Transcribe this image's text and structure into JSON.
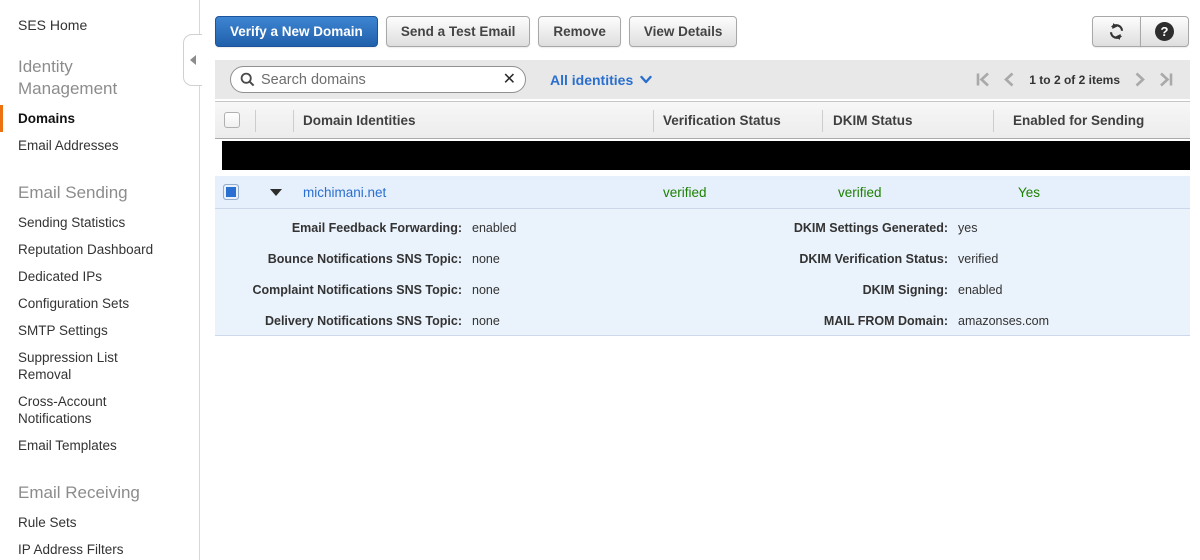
{
  "sidebar": {
    "home": "SES Home",
    "sections": [
      {
        "header": "Identity Management",
        "items": [
          "Domains",
          "Email Addresses"
        ]
      },
      {
        "header": "Email Sending",
        "items": [
          "Sending Statistics",
          "Reputation Dashboard",
          "Dedicated IPs",
          "Configuration Sets",
          "SMTP Settings",
          "Suppression List Removal",
          "Cross-Account Notifications",
          "Email Templates"
        ]
      },
      {
        "header": "Email Receiving",
        "items": [
          "Rule Sets",
          "IP Address Filters"
        ]
      }
    ],
    "active_item": "Domains"
  },
  "toolbar": {
    "verify_button": "Verify a New Domain",
    "test_email_button": "Send a Test Email",
    "remove_button": "Remove",
    "view_details_button": "View Details",
    "icons": {
      "refresh": "circular-refresh-arrows",
      "help": "?"
    }
  },
  "filter_bar": {
    "search_placeholder": "Search domains",
    "clear_glyph": "✕",
    "identity_filter_label": "All identities",
    "pagination_text": "1 to 2 of 2 items"
  },
  "table": {
    "headers": {
      "domain": "Domain Identities",
      "verification": "Verification Status",
      "dkim": "DKIM Status",
      "enabled": "Enabled for Sending"
    },
    "redacted_row": {
      "redacted": true
    },
    "domain_row": {
      "selected": true,
      "expanded": true,
      "domain": "michimani.net",
      "verification_status": "verified",
      "dkim_status": "verified",
      "enabled_for_sending": "Yes",
      "details": {
        "left": [
          {
            "label": "Email Feedback Forwarding:",
            "value": "enabled"
          },
          {
            "label": "Bounce Notifications SNS Topic:",
            "value": "none"
          },
          {
            "label": "Complaint Notifications SNS Topic:",
            "value": "none"
          },
          {
            "label": "Delivery Notifications SNS Topic:",
            "value": "none"
          }
        ],
        "right": [
          {
            "label": "DKIM Settings Generated:",
            "value": "yes"
          },
          {
            "label": "DKIM Verification Status:",
            "value": "verified"
          },
          {
            "label": "DKIM Signing:",
            "value": "enabled"
          },
          {
            "label": "MAIL FROM Domain:",
            "value": "amazonses.com"
          }
        ]
      }
    }
  },
  "colors": {
    "primary_button_blue": "#2e74c4",
    "link_blue": "#2a6fce",
    "status_green": "#1d8102",
    "active_nav_orange": "#ec7211",
    "selected_row_blue": "#e6effc",
    "detail_panel_blue": "#eaf2fb",
    "redaction_black": "#000000"
  }
}
